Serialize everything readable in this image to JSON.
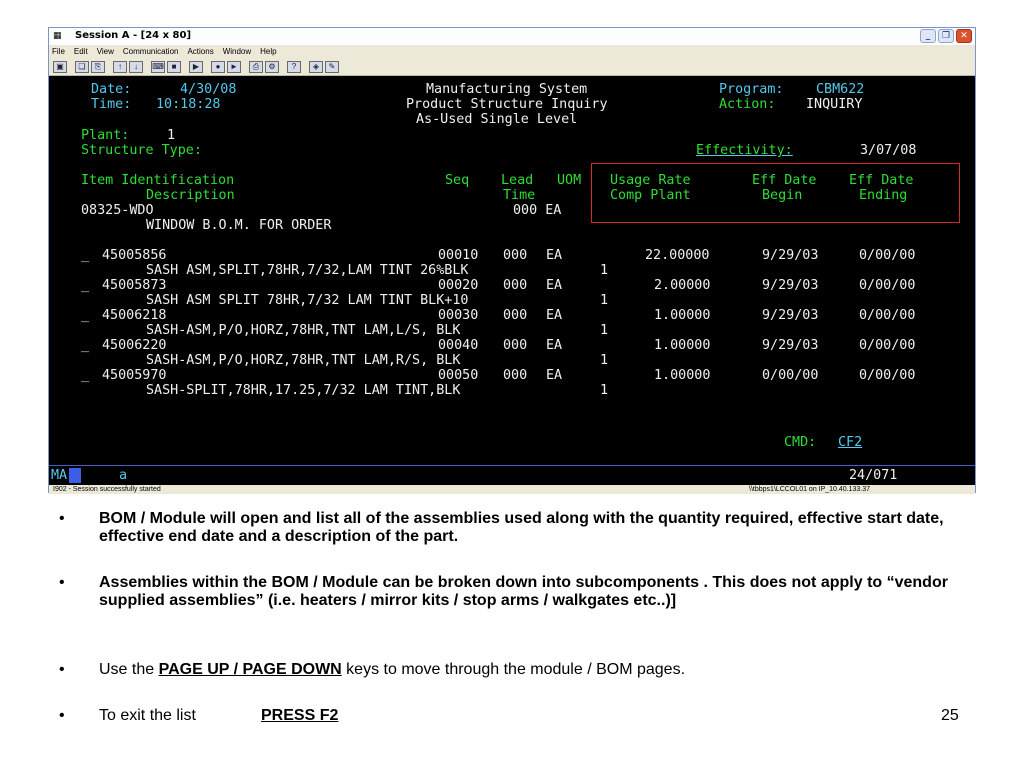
{
  "window": {
    "title": "Session A - [24 x 80]",
    "icon": "terminal-session-icon",
    "buttons": [
      "minimize-icon",
      "restore-icon",
      "close-icon"
    ]
  },
  "menu": [
    "File",
    "Edit",
    "View",
    "Communication",
    "Actions",
    "Window",
    "Help"
  ],
  "toolbar": {
    "icons": [
      "display-icon",
      "copy-icon",
      "paste-icon",
      "send-icon",
      "receive-icon",
      "keyboard-icon",
      "screen-icon",
      "macro-icon",
      "record-icon",
      "play-icon",
      "print-icon",
      "setup-icon",
      "help-icon",
      "map-icon",
      "edit-icon"
    ]
  },
  "terminal": {
    "date_label": "Date:",
    "date": "4/30/08",
    "time_label": "Time:",
    "time": "10:18:28",
    "system": "Manufacturing System",
    "program_label": "Program:",
    "program": "CBM622",
    "inquiry_title": "Product Structure Inquiry",
    "action_label": "Action:",
    "action": "INQUIRY",
    "subtitle": "As-Used Single Level",
    "plant_label": "Plant:",
    "plant": "1",
    "structure_type_label": "Structure Type:",
    "effectivity_label": "Effectivity:",
    "effectivity": "3/07/08",
    "headers": {
      "item_identification": "Item Identification",
      "description": "Description",
      "seq": "Seq",
      "lead": "Lead",
      "time": "Time",
      "uom": "UOM",
      "usage_rate": "Usage Rate",
      "comp_plant": "Comp Plant",
      "eff_date_begin_1": "Eff Date",
      "begin": "Begin",
      "eff_date_end_1": "Eff Date",
      "ending": "Ending"
    },
    "parent": {
      "item": "08325-WDO",
      "lead_uom": "000 EA",
      "description": "WINDOW B.O.M. FOR ORDER"
    },
    "rows": [
      {
        "sel": "_",
        "item": "45005856",
        "seq": "00010",
        "lead": "000",
        "uom": "EA",
        "usage": "22.00000",
        "begin": "9/29/03",
        "end": "0/00/00",
        "desc": "SASH ASM,SPLIT,78HR,7/32,LAM TINT 26%BLK",
        "plant": "1"
      },
      {
        "sel": "_",
        "item": "45005873",
        "seq": "00020",
        "lead": "000",
        "uom": "EA",
        "usage": "2.00000",
        "begin": "9/29/03",
        "end": "0/00/00",
        "desc": "SASH ASM SPLIT 78HR,7/32 LAM TINT BLK+10",
        "plant": "1"
      },
      {
        "sel": "_",
        "item": "45006218",
        "seq": "00030",
        "lead": "000",
        "uom": "EA",
        "usage": "1.00000",
        "begin": "9/29/03",
        "end": "0/00/00",
        "desc": "SASH-ASM,P/O,HORZ,78HR,TNT LAM,L/S, BLK",
        "plant": "1"
      },
      {
        "sel": "_",
        "item": "45006220",
        "seq": "00040",
        "lead": "000",
        "uom": "EA",
        "usage": "1.00000",
        "begin": "9/29/03",
        "end": "0/00/00",
        "desc": "SASH-ASM,P/O,HORZ,78HR,TNT LAM,R/S, BLK",
        "plant": "1"
      },
      {
        "sel": "_",
        "item": "45005970",
        "seq": "00050",
        "lead": "000",
        "uom": "EA",
        "usage": "1.00000",
        "begin": "0/00/00",
        "end": "0/00/00",
        "desc": "SASH-SPLIT,78HR,17.25,7/32 LAM TINT,BLK",
        "plant": "1"
      }
    ],
    "cmd_label": "CMD:",
    "cmd_value": "CF2",
    "oia_left": "MA",
    "oia_a": "a",
    "cursor_pos": "24/071"
  },
  "statusbar": {
    "message": "I902 - Session successfully started",
    "host": "\\\\tbbps1\\LCCOL01 on IP_10.40.133.37"
  },
  "slide": {
    "bullet_char": "•",
    "b1": "BOM / Module will open and list all of the assemblies used along with the quantity required, effective start date, effective end date and a description of the part.",
    "b2": "Assemblies within the BOM / Module can be broken down into subcomponents . This does not apply to “vendor supplied assemblies” (i.e. heaters / mirror kits / stop arms / walkgates etc..)]",
    "b3_pre": "Use the ",
    "b3_keys": "PAGE UP / PAGE DOWN",
    "b3_post": " keys to move through the module / BOM pages.",
    "b4_pre": "To exit the list",
    "b4_action": "PRESS F2",
    "page_number": "25"
  },
  "colors": {
    "terminal_bg": "#000000",
    "cyan": "#53c8ee",
    "green": "#2fdd36",
    "white": "#f0f0f0",
    "highlight_box": "#d22a2a"
  }
}
